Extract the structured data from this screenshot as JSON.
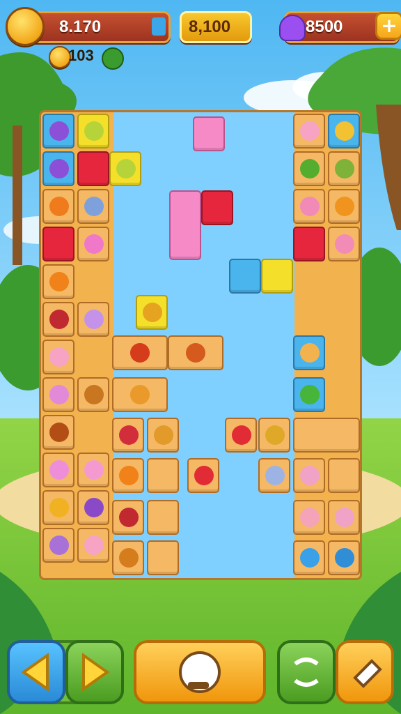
{
  "hud": {
    "score_value": "8.170",
    "center_value": "8,100",
    "gems_value": "8500",
    "coins_value": "103"
  },
  "colors": {
    "tile_orange": "#f5b865",
    "tile_blue": "#4ab4ec",
    "tile_red": "#e5263c",
    "tile_pink": "#f58ac7",
    "tile_yellow": "#f4e02a",
    "hud_red": "#b3401f",
    "button_blue": "#3aa0e8",
    "button_green": "#6fbf3a",
    "button_orange": "#f6a51c"
  },
  "buttons": {
    "left": {
      "icon": "arrow-left-icon"
    },
    "right": {
      "icon": "arrow-right-icon"
    },
    "center": {
      "icon": "hint-magnifier-icon"
    },
    "shuffle": {
      "icon": "shuffle-icon"
    },
    "eraser": {
      "icon": "eraser-icon"
    }
  }
}
